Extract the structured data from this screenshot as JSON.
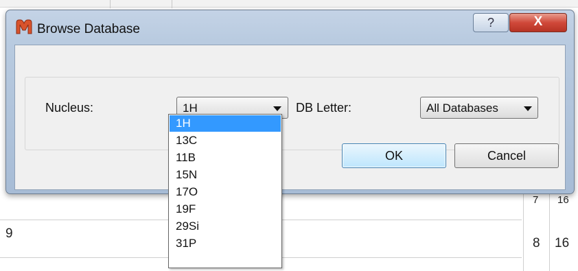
{
  "dialog": {
    "title": "Browse Database",
    "help_label": "?",
    "close_label": "X"
  },
  "form": {
    "nucleus_label": "Nucleus:",
    "nucleus_value": "1H",
    "db_letter_label": "DB Letter:",
    "db_letter_value": "All Databases"
  },
  "buttons": {
    "ok": "OK",
    "cancel": "Cancel"
  },
  "dropdown": {
    "items": [
      "1H",
      "13C",
      "11B",
      "15N",
      "17O",
      "19F",
      "29Si",
      "31P"
    ],
    "selected_index": 0
  },
  "background": {
    "row_label": "9",
    "cell_a": "7",
    "cell_b": "16",
    "cell_c": "8",
    "cell_d": "16"
  },
  "colors": {
    "selection": "#3399ff",
    "close_button": "#d0493a",
    "title_bar": "#b9cbe0",
    "app_icon": "#d9532c"
  },
  "icons": {
    "app": "m-logo-icon",
    "dropdown_arrow": "chevron-down-icon"
  }
}
